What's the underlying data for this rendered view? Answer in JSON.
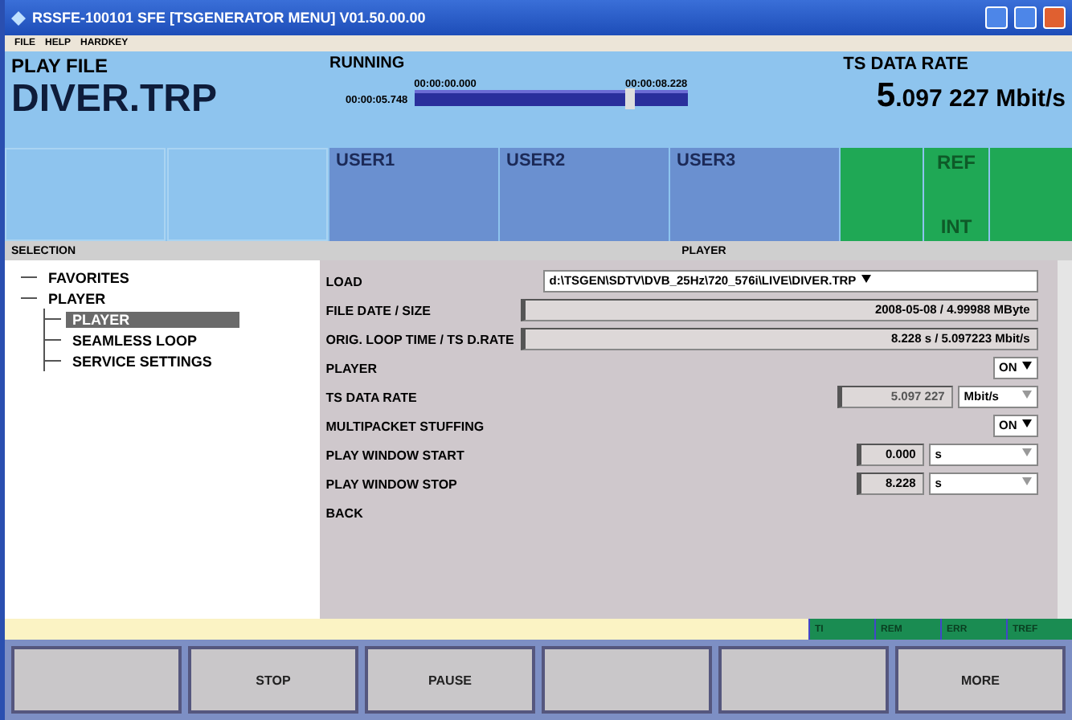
{
  "window": {
    "title": "RSSFE-100101  SFE [TSGENERATOR MENU]  V01.50.00.00"
  },
  "menu": [
    "FILE",
    "HELP",
    "HARDKEY"
  ],
  "play_file": {
    "label": "PLAY FILE",
    "name": "DIVER.TRP"
  },
  "running": {
    "label": "RUNNING",
    "start": "00:00:05.748",
    "position": "00:00:00.000",
    "end": "00:00:08.228",
    "level": 0.79
  },
  "ts_data_rate": {
    "label": "TS DATA RATE",
    "value_lead": "5",
    "value_rest": ".097 227 Mbit/s"
  },
  "user_keys": [
    "USER1",
    "USER2",
    "USER3"
  ],
  "ref": {
    "label": "REF",
    "value": "INT"
  },
  "selection": {
    "title": "SELECTION",
    "tree": [
      {
        "label": "FAVORITES",
        "selected": false
      },
      {
        "label": "PLAYER",
        "selected": false,
        "children": [
          {
            "label": "PLAYER",
            "selected": true
          },
          {
            "label": "SEAMLESS LOOP",
            "selected": false
          },
          {
            "label": "SERVICE SETTINGS",
            "selected": false
          }
        ]
      }
    ]
  },
  "player": {
    "title": "PLAYER",
    "rows": [
      {
        "kind": "select",
        "label": "LOAD",
        "value": "d:\\TSGEN\\SDTV\\DVB_25Hz\\720_576i\\LIVE\\DIVER.TRP"
      },
      {
        "kind": "display",
        "label": "FILE DATE / SIZE",
        "value": "2008-05-08 / 4.99988 MByte"
      },
      {
        "kind": "display",
        "label": "ORIG. LOOP TIME / TS D.RATE",
        "value": "8.228 s / 5.097223 Mbit/s"
      },
      {
        "kind": "toggle",
        "label": "PLAYER",
        "value": "ON"
      },
      {
        "kind": "number",
        "label": "TS DATA RATE",
        "value": "5.097 227",
        "unit": "Mbit/s",
        "disabled": true
      },
      {
        "kind": "toggle",
        "label": "MULTIPACKET STUFFING",
        "value": "ON"
      },
      {
        "kind": "number",
        "label": "PLAY WINDOW START",
        "value": "0.000",
        "unit": "s",
        "disabled": false
      },
      {
        "kind": "number",
        "label": "PLAY WINDOW STOP",
        "value": "8.228",
        "unit": "s",
        "disabled": false
      },
      {
        "kind": "action",
        "label": "BACK"
      }
    ]
  },
  "indicators": [
    "TI",
    "REM",
    "ERR",
    "TREF"
  ],
  "softkeys": [
    {
      "kind": "blank"
    },
    {
      "kind": "labeled",
      "label": "STOP"
    },
    {
      "kind": "labeled",
      "label": "PAUSE"
    },
    {
      "kind": "blank"
    },
    {
      "kind": "blank"
    },
    {
      "kind": "labeled",
      "label": "MORE"
    }
  ]
}
